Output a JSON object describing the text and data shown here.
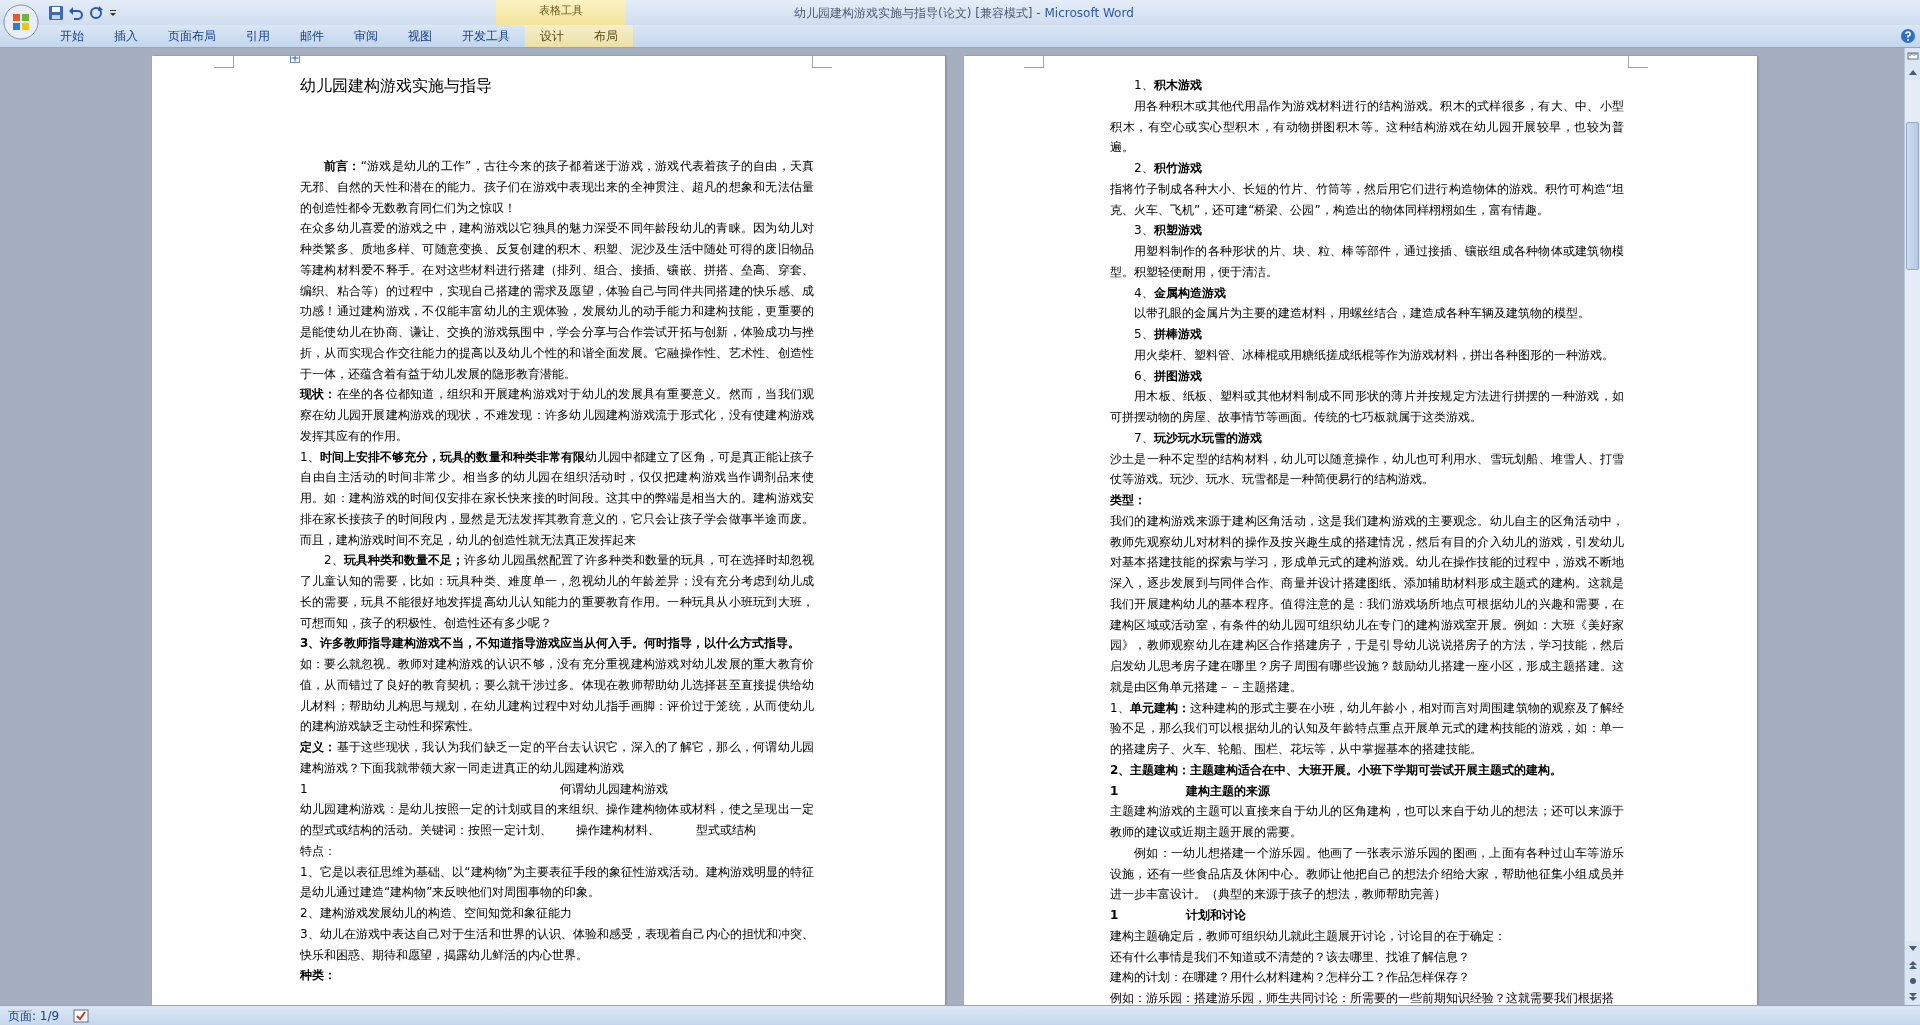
{
  "window": {
    "document_title": "幼儿园建构游戏实施与指导(论文) [兼容模式] - ",
    "app_name": "Microsoft Word",
    "context_group": "表格工具"
  },
  "tabs": [
    {
      "label": "开始",
      "contextual": false
    },
    {
      "label": "插入",
      "contextual": false
    },
    {
      "label": "页面布局",
      "contextual": false
    },
    {
      "label": "引用",
      "contextual": false
    },
    {
      "label": "邮件",
      "contextual": false
    },
    {
      "label": "审阅",
      "contextual": false
    },
    {
      "label": "视图",
      "contextual": false
    },
    {
      "label": "开发工具",
      "contextual": false
    },
    {
      "label": "设计",
      "contextual": true
    },
    {
      "label": "布局",
      "contextual": true
    }
  ],
  "pages": [
    {
      "paragraphs": [
        {
          "kind": "title",
          "text": "幼儿园建构游戏实施与指导"
        },
        {
          "kind": "indented",
          "text": "**前言：**“游戏是幼儿的工作”，古往今来的孩子都着迷于游戏，游戏代表着孩子的自由，天真无邪、自然的天性和潜在的能力。孩子们在游戏中表现出来的全神贯注、超凡的想象和无法估量的创造性都令无数教育同仁们为之惊叹！"
        },
        {
          "kind": "para",
          "text": "在众多幼儿喜爱的游戏之中，建构游戏以它独具的魅力深受不同年龄段幼儿的青睐。因为幼儿对种类繁多、质地多样、可随意变换、反复创建的积木、积塑、泥沙及生活中随处可得的废旧物品等建构材料爱不释手。在对这些材料进行搭建（排列、组合、接插、镶嵌、拼搭、垒高、穿套、编织、粘合等）的过程中，实现自己搭建的需求及愿望，体验自己与同伴共同搭建的快乐感、成功感！通过建构游戏，不仅能丰富幼儿的主观体验，发展幼儿的动手能力和建构技能，更重要的是能使幼儿在协商、谦让、交换的游戏氛围中，学会分享与合作尝试开拓与创新，体验成功与挫折，从而实现合作交往能力的提高以及幼儿个性的和谐全面发展。它融操作性、艺术性、创造性于一体，还蕴含着有益于幼儿发展的隐形教育潜能。"
        },
        {
          "kind": "para",
          "text": "**现状：**在坐的各位都知道，组织和开展建构游戏对于幼儿的发展具有重要意义。然而，当我们观察在幼儿园开展建构游戏的现状，不难发现：许多幼儿园建构游戏流于形式化，没有使建构游戏发挥其应有的作用。"
        },
        {
          "kind": "para",
          "text": "1、**时间上安排不够充分，玩具的数量和种类非常有限**幼儿园中都建立了区角，可是真正能让孩子自由自主活动的时间非常少。相当多的幼儿园在组织活动时，仅仅把建构游戏当作调剂品来使用。如：建构游戏的时间仅安排在家长快来接的时间段。这其中的弊端是相当大的。建构游戏安排在家长接孩子的时间段内，显然是无法发挥其教育意义的，它只会让孩子学会做事半途而废。而且，建构游戏时间不充足，幼儿的创造性就无法真正发挥起来"
        },
        {
          "kind": "indented",
          "text": "2、**玩具种类和数量不足；**许多幼儿园虽然配置了许多种类和数量的玩具，可在选择时却忽视了儿童认知的需要，比如：玩具种类、难度单一，忽视幼儿的年龄差异；没有充分考虑到幼儿成长的需要，玩具不能很好地发挥提高幼儿认知能力的重要教育作用。一种玩具从小班玩到大班，可想而知，孩子的积极性、创造性还有多少呢？"
        },
        {
          "kind": "heading",
          "text": "3、许多教师指导建构游戏不当，不知道指导游戏应当从何入手。何时指导，以什么方式指导。"
        },
        {
          "kind": "para",
          "text": "如：要么就忽视。教师对建构游戏的认识不够，没有充分重视建构游戏对幼儿发展的重大教育价值，从而错过了良好的教育契机；要么就干涉过多。体现在教师帮助幼儿选择甚至直接提供给幼儿材料；帮助幼儿构思与规划，在幼儿建构过程中对幼儿指手画脚：评价过于笼统，从而使幼儿的建构游戏缺乏主动性和探索性。"
        },
        {
          "kind": "para",
          "text": "**定义：**基于这些现状，我认为我们缺乏一定的平台去认识它，深入的了解它，那么，何谓幼儿园建构游戏？下面我就带领大家一同走进真正的幼儿园建构游戏"
        },
        {
          "kind": "numbered",
          "number": "1",
          "text": "何谓幼儿园建构游戏"
        },
        {
          "kind": "para",
          "text": "幼儿园建构游戏：是幼儿按照一定的计划或目的来组织、操作建构物体或材料，使之呈现出一定的型式或结构的活动。关键词：按照一定计划、　　操作建构材料、　　　型式或结构"
        },
        {
          "kind": "para",
          "text": "特点："
        },
        {
          "kind": "para",
          "text": "1、它是以表征思维为基础、以“建构物”为主要表征手段的象征性游戏活动。建构游戏明显的特征是幼儿通过建造“建构物”来反映他们对周围事物的印象。"
        },
        {
          "kind": "para",
          "text": "2、建构游戏发展幼儿的构造、空间知觉和象征能力"
        },
        {
          "kind": "para",
          "text": "3、幼儿在游戏中表达自己对于生活和世界的认识、体验和感受，表现着自己内心的担忧和冲突、快乐和困惑、期待和愿望，揭露幼儿鲜活的内心世界。"
        },
        {
          "kind": "heading",
          "text": "种类："
        }
      ]
    },
    {
      "paragraphs": [
        {
          "kind": "indented",
          "text": "1、**积木游戏**"
        },
        {
          "kind": "indented",
          "text": "用各种积木或其他代用晶作为游戏材料进行的结构游戏。积木的式样很多，有大、中、小型积木，有空心或实心型积木，有动物拼图积木等。这种结构游戏在幼儿园开展较早，也较为普遍。"
        },
        {
          "kind": "indented",
          "text": "2、**积竹游戏**"
        },
        {
          "kind": "para",
          "text": "指将竹子制成各种大小、长短的竹片、竹筒等，然后用它们进行构造物体的游戏。积竹可构造“坦克、火车、飞机”，还可建“桥梁、公园”，构造出的物体同样栩栩如生，富有情趣。"
        },
        {
          "kind": "indented",
          "text": "3、**积塑游戏**"
        },
        {
          "kind": "indented",
          "text": "用塑料制作的各种形状的片、块、粒、棒等部件，通过接插、镶嵌组成各种物体或建筑物模型。积塑轻便耐用，便于清洁。"
        },
        {
          "kind": "indented",
          "text": "4、**金属构造游戏**"
        },
        {
          "kind": "indented",
          "text": "以带孔眼的金属片为主要的建造材料，用螺丝结合，建造成各种车辆及建筑物的模型。"
        },
        {
          "kind": "indented",
          "text": "5、**拼棒游戏**"
        },
        {
          "kind": "indented",
          "text": "用火柴杆、塑料管、冰棒棍或用糖纸搓成纸棍等作为游戏材料，拼出各种图形的一种游戏。"
        },
        {
          "kind": "indented",
          "text": "6、**拼图游戏**"
        },
        {
          "kind": "indented",
          "text": "用木板、纸板、塑料或其他材料制成不同形状的薄片并按规定方法进行拼摆的一种游戏，如可拼摆动物的房屋、故事情节等画面。传统的七巧板就属于这类游戏。"
        },
        {
          "kind": "indented",
          "text": "7、**玩沙玩水玩雪的游戏**"
        },
        {
          "kind": "para",
          "text": "沙土是一种不定型的结构材料，幼儿可以随意操作，幼儿也可利用水、雪玩划船、堆雪人、打雪仗等游戏。玩沙、玩水、玩雪都是一种简便易行的结构游戏。"
        },
        {
          "kind": "heading",
          "text": "类型："
        },
        {
          "kind": "para",
          "text": "我们的建构游戏来源于建构区角活动，这是我们建构游戏的主要观念。幼儿自主的区角活动中，教师先观察幼儿对材料的操作及按兴趣生成的搭建情况，然后有目的介入幼儿的游戏，引发幼儿对基本搭建技能的探索与学习，形成单元式的建构游戏。幼儿在操作技能的过程中，游戏不断地深入，逐步发展到与同伴合作、商量并设计搭建图纸、添加辅助材料形成主题式的建构。这就是我们开展建构幼儿的基本程序。值得注意的是：我们游戏场所地点可根据幼儿的兴趣和需要，在建构区域或活动室，有条件的幼儿园可组织幼儿在专门的建构游戏室开展。例如：大班《美好家园》，教师观察幼儿在建构区合作搭建房子，于是引导幼儿说说搭房子的方法，学习技能，然后启发幼儿思考房子建在哪里？房子周围有哪些设施？鼓励幼儿搭建一座小区，形成主题搭建。这就是由区角单元搭建－－主题搭建。"
        },
        {
          "kind": "para",
          "text": "1、**单元建构：**这种建构的形式主要在小班，幼儿年龄小，相对而言对周围建筑物的观察及了解经验不足，那么我们可以根据幼儿的认知及年龄特点重点开展单元式的建构技能的游戏，如：单一的搭建房子、火车、轮船、围栏、花坛等，从中掌握基本的搭建技能。"
        },
        {
          "kind": "heading",
          "text": "2、主题建构：主题建构适合在中、大班开展。小班下学期可尝试开展主题式的建构。"
        },
        {
          "kind": "numbered-heading",
          "number": "1",
          "text": "建构主题的来源"
        },
        {
          "kind": "para",
          "text": "主题建构游戏的主题可以直接来自于幼儿的区角建构，也可以来自于幼儿的想法；还可以来源于教师的建议或近期主题开展的需要。"
        },
        {
          "kind": "indented",
          "text": "例如：一幼儿想搭建一个游乐园。他画了一张表示游乐园的图画，上面有各种过山车等游乐设施，还有一些食品店及休闲中心。教师让他把自己的想法介绍给大家，帮助他征集小组成员并进一步丰富设计。（典型的来源于孩子的想法，教师帮助完善）"
        },
        {
          "kind": "numbered-heading",
          "number": "1",
          "text": "计划和讨论"
        },
        {
          "kind": "para",
          "text": "建构主题确定后，教师可组织幼儿就此主题展开讨论，讨论目的在于确定："
        },
        {
          "kind": "para",
          "text": "还有什么事情是我们不知道或不清楚的？该去哪里、找谁了解信息？"
        },
        {
          "kind": "para",
          "text": "建构的计划：在哪建？用什么材料建构？怎样分工？作品怎样保存？"
        },
        {
          "kind": "para",
          "text": "例如：游乐园：搭建游乐园，师生共同讨论：所需要的一些前期知识经验？这就需要我们根据搭"
        }
      ]
    }
  ],
  "status_bar": {
    "page": "页面: 1/9"
  }
}
